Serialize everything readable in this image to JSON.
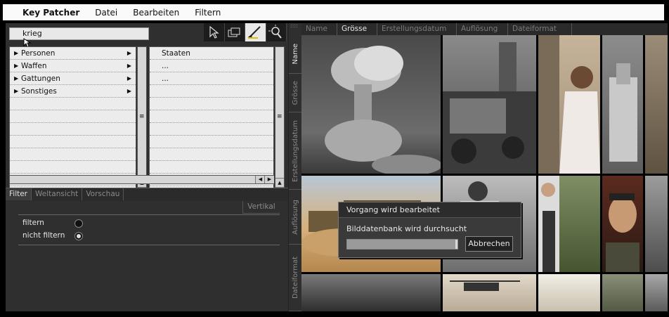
{
  "app": {
    "name": "Key Patcher",
    "menu": [
      "Datei",
      "Bearbeiten",
      "Filtern"
    ]
  },
  "search": {
    "value": "krieg"
  },
  "tools": [
    "pointer-icon",
    "stack-icon",
    "brush-icon",
    "zoom-icon"
  ],
  "categories": [
    {
      "label": "Personen"
    },
    {
      "label": "Waffen"
    },
    {
      "label": "Gattungen"
    },
    {
      "label": "Sonstiges"
    }
  ],
  "subcategories": [
    "Staaten",
    "...",
    "..."
  ],
  "bottom_tabs": [
    "Filter",
    "Weltansicht",
    "Vorschau"
  ],
  "orientation": "Vertikal",
  "filter_options": [
    {
      "label": "filtern",
      "selected": false
    },
    {
      "label": "nicht filtern",
      "selected": true
    }
  ],
  "side_tabs": [
    "Name",
    "Grösse",
    "Erstellungsdatum",
    "Auflösung",
    "Dateiformat"
  ],
  "columns": [
    "Name",
    "Grösse",
    "Erstellungsdatum",
    "Auflösung",
    "Dateiformat"
  ],
  "active_column": "Grösse",
  "dialog": {
    "title": "Vorgang wird bearbeitet",
    "message": "Bilddatenbank wird durchsucht",
    "progress": 0.98,
    "cancel_label": "Abbrechen"
  }
}
